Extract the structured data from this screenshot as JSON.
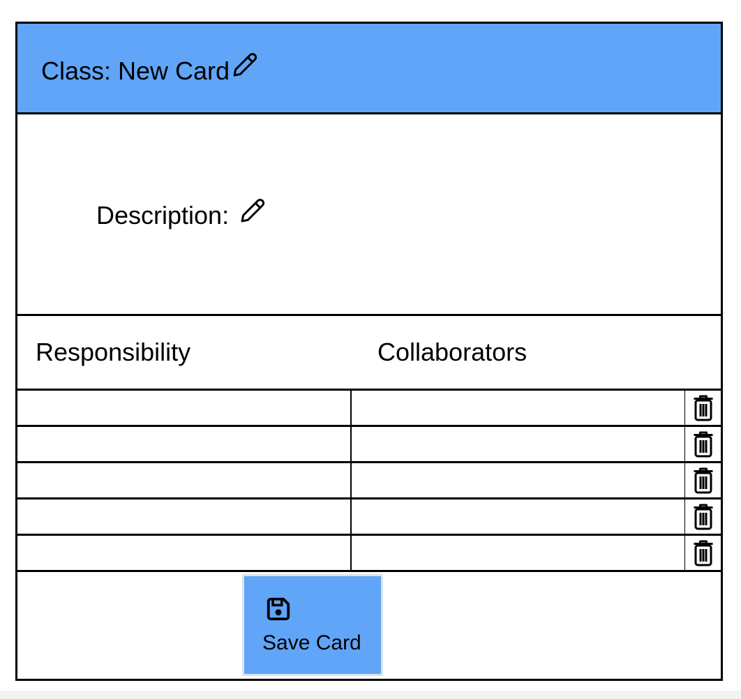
{
  "card": {
    "class_title": "Class: New Card",
    "description_label": "Description:",
    "columns": {
      "responsibility": "Responsibility",
      "collaborators": "Collaborators"
    },
    "rows": [
      {
        "responsibility": "",
        "collaborator": ""
      },
      {
        "responsibility": "",
        "collaborator": ""
      },
      {
        "responsibility": "",
        "collaborator": ""
      },
      {
        "responsibility": "",
        "collaborator": ""
      },
      {
        "responsibility": "",
        "collaborator": ""
      }
    ],
    "save_label": "Save Card"
  },
  "icons": {
    "edit": "pencil-icon",
    "delete": "trash-icon",
    "save": "floppy-disk-icon"
  },
  "colors": {
    "header_bg": "#60a5f8",
    "button_bg": "#60a5f8",
    "border": "#000000"
  }
}
